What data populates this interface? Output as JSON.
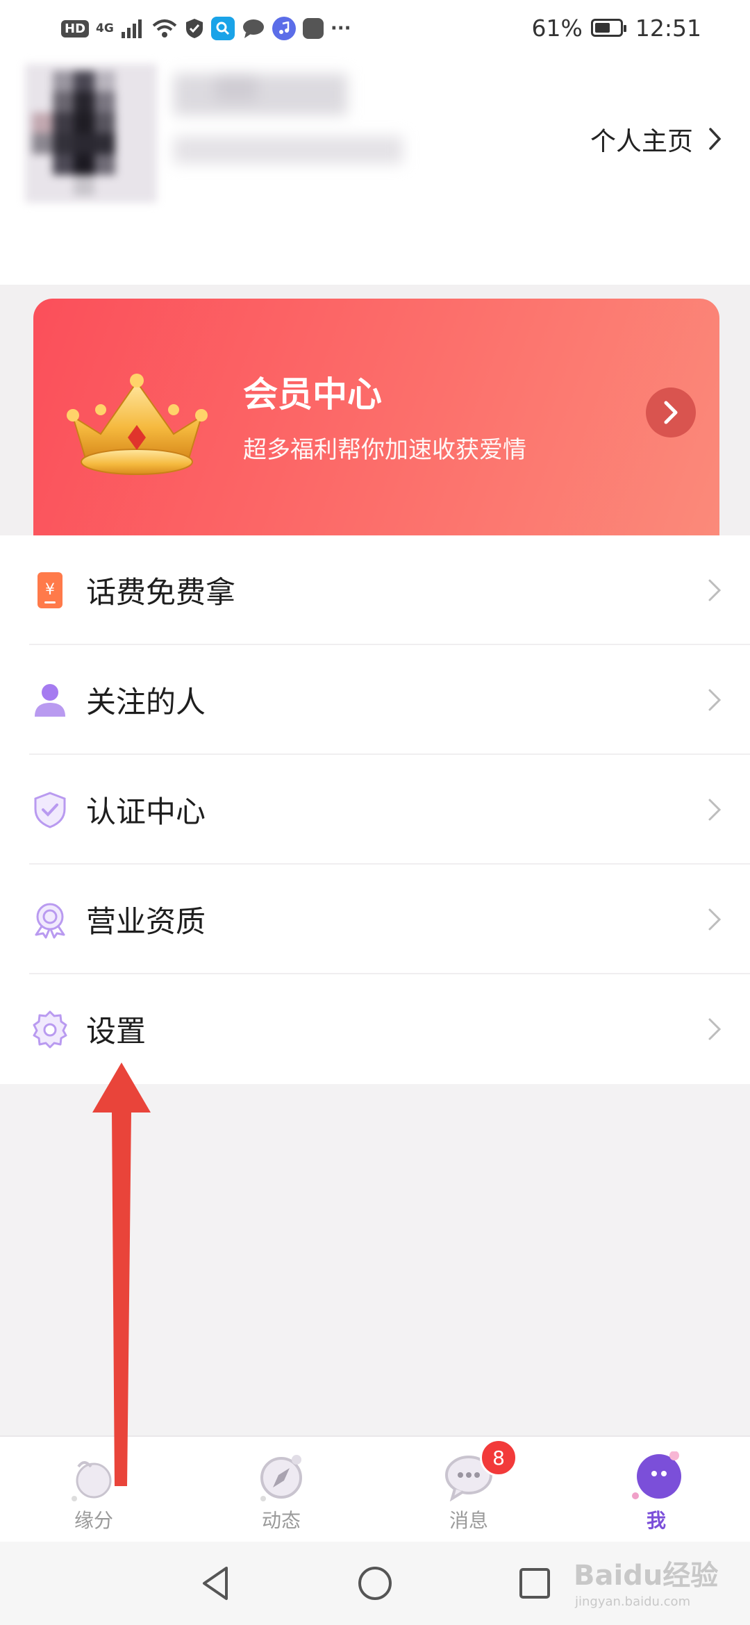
{
  "status_bar": {
    "left_hd": "HD",
    "left_net": "4G",
    "icon_names": [
      "wifi-icon",
      "shield-icon",
      "search-app-icon",
      "chat-app-icon",
      "music-app-icon",
      "huawei-app-icon"
    ],
    "more": "···",
    "battery": "61%",
    "battery_level": 0.61,
    "time": "12:51"
  },
  "header": {
    "profile_link": "个人主页"
  },
  "vip": {
    "title": "会员中心",
    "subtitle": "超多福利帮你加速收获爱情",
    "gradient": [
      "#fb4f5a",
      "#fb8a7a"
    ]
  },
  "menu": [
    {
      "label": "话费免费拿",
      "icon": "phone-credit-icon"
    },
    {
      "label": "关注的人",
      "icon": "person-icon"
    },
    {
      "label": "认证中心",
      "icon": "verified-shield-icon"
    },
    {
      "label": "营业资质",
      "icon": "badge-ribbon-icon"
    },
    {
      "label": "设置",
      "icon": "gear-icon"
    }
  ],
  "tabs": [
    {
      "label": "缘分",
      "icon": "hand-heart-icon",
      "active": false
    },
    {
      "label": "动态",
      "icon": "compass-icon",
      "active": false
    },
    {
      "label": "消息",
      "icon": "message-bubble-icon",
      "active": false,
      "badge": "8"
    },
    {
      "label": "我",
      "icon": "me-face-icon",
      "active": true
    }
  ],
  "watermark": {
    "brand": "Baidu经验",
    "url": "jingyan.baidu.com"
  },
  "colors": {
    "accent": "#7b4fd9",
    "icon_purple": "#b99af0",
    "annotation_red": "#e9443a",
    "badge_red": "#f23a3a"
  }
}
